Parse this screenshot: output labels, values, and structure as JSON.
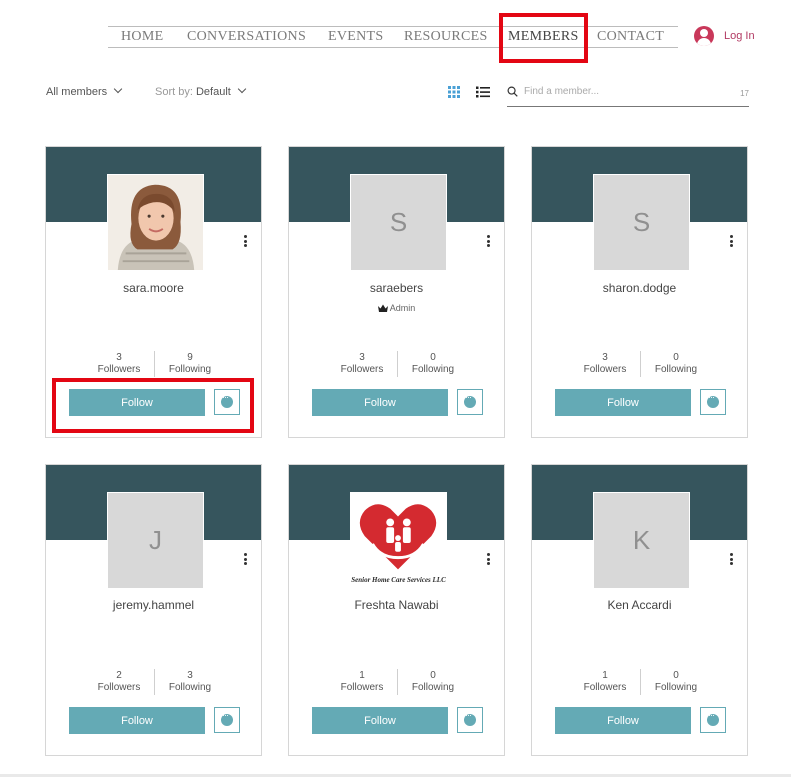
{
  "nav": {
    "items": [
      "HOME",
      "CONVERSATIONS",
      "EVENTS",
      "RESOURCES",
      "MEMBERS",
      "CONTACT"
    ],
    "login_label": "Log In"
  },
  "toolbar": {
    "filter_label": "All members",
    "sort_prefix": "Sort by:",
    "sort_value": "Default",
    "search_placeholder": "Find a member...",
    "member_count": "17"
  },
  "members": [
    {
      "name": "sara.moore",
      "role": "",
      "initial": "",
      "photo": "portrait",
      "followers": "3",
      "following": "9"
    },
    {
      "name": "saraebers",
      "role": "Admin",
      "initial": "S",
      "photo": "",
      "followers": "3",
      "following": "0"
    },
    {
      "name": "sharon.dodge",
      "role": "",
      "initial": "S",
      "photo": "",
      "followers": "3",
      "following": "0"
    },
    {
      "name": "jeremy.hammel",
      "role": "",
      "initial": "J",
      "photo": "",
      "followers": "2",
      "following": "3"
    },
    {
      "name": "Freshta Nawabi",
      "role": "",
      "initial": "",
      "photo": "logo",
      "logo_text": "Senior Home Care Services LLC",
      "followers": "1",
      "following": "0"
    },
    {
      "name": "Ken Accardi",
      "role": "",
      "initial": "K",
      "photo": "",
      "followers": "1",
      "following": "0"
    }
  ],
  "labels": {
    "followers": "Followers",
    "following": "Following",
    "follow_button": "Follow"
  },
  "colors": {
    "cover": "#36555d",
    "accent": "#64aab5",
    "highlight": "#e30613",
    "login": "#b23a63"
  }
}
